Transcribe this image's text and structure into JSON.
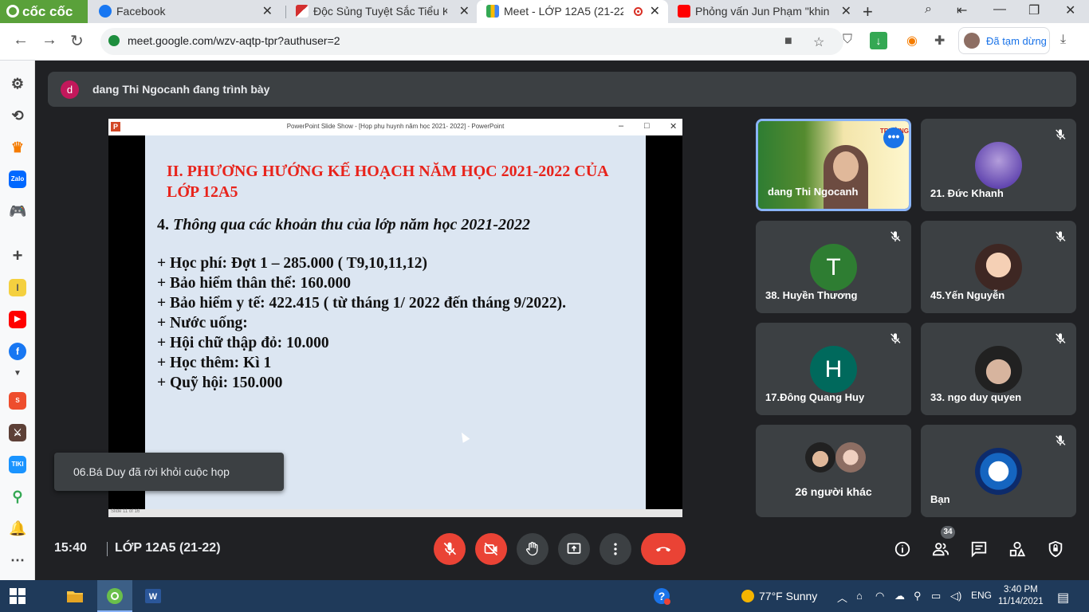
{
  "browser": {
    "brand": "cốc cốc",
    "tabs": [
      {
        "title": "Facebook"
      },
      {
        "title": "Độc Sủng Tuyệt Sắc Tiểu Kiều"
      },
      {
        "title": "Meet - LỚP 12A5 (21-22)"
      },
      {
        "title": "Phỏng vấn Jun Phạm \"khinh"
      }
    ],
    "url": "meet.google.com/wzv-aqtp-tpr?authuser=2",
    "profile_status": "Đã tạm dừng"
  },
  "meet": {
    "presenter_initial": "d",
    "presenting_text": "dang Thi Ngocanh đang trình bày",
    "toast": "06.Bá Duy đã rời khỏi cuộc họp",
    "meeting_time": "15:40",
    "meeting_code": "LỚP 12A5 (21-22)",
    "people_count": "34"
  },
  "slide": {
    "window_title": "PowerPoint Slide Show - [Họp phụ huynh năm học 2021- 2022] - PowerPoint",
    "heading": "II. PHƯƠNG HƯỚNG KẾ HOẠCH NĂM HỌC 2021-2022 CỦA LỚP 12A5",
    "sub_number": "4.",
    "sub_text": "Thông qua các khoản thu của lớp năm học 2021-2022",
    "lines": [
      "+ Học phí: Đợt 1 – 285.000 ( T9,10,11,12)",
      "+ Bảo hiểm thân thể: 160.000",
      "+ Bảo hiểm y tế: 422.415 ( từ tháng 1/ 2022 đến tháng 9/2022).",
      "+ Nước uống:",
      "+ Hội chữ thập đỏ: 10.000",
      "+ Học thêm: Kì 1",
      "+ Quỹ hội: 150.000"
    ],
    "status": "Slide 11 of 16"
  },
  "participants": [
    {
      "name": "dang Thi Ngocanh"
    },
    {
      "name": "21. Đức Khanh"
    },
    {
      "name": "38. Huyền Thương",
      "initial": "T"
    },
    {
      "name": "45.Yến Nguyễn"
    },
    {
      "name": "17.Đông Quang Huy",
      "initial": "H"
    },
    {
      "name": "33. ngo duy quyen"
    },
    {
      "name": "26 người khác"
    },
    {
      "name": "Bạn"
    }
  ],
  "taskbar": {
    "weather": "77°F  Sunny",
    "language": "ENG",
    "time": "3:40 PM",
    "date": "11/14/2021"
  },
  "colors": {
    "meet_bg": "#202124",
    "tile_bg": "#3c4043",
    "danger": "#ea4335",
    "slide_heading": "#e8231b",
    "slide_bg": "#dce6f2",
    "accent_blue": "#1a73e8"
  }
}
